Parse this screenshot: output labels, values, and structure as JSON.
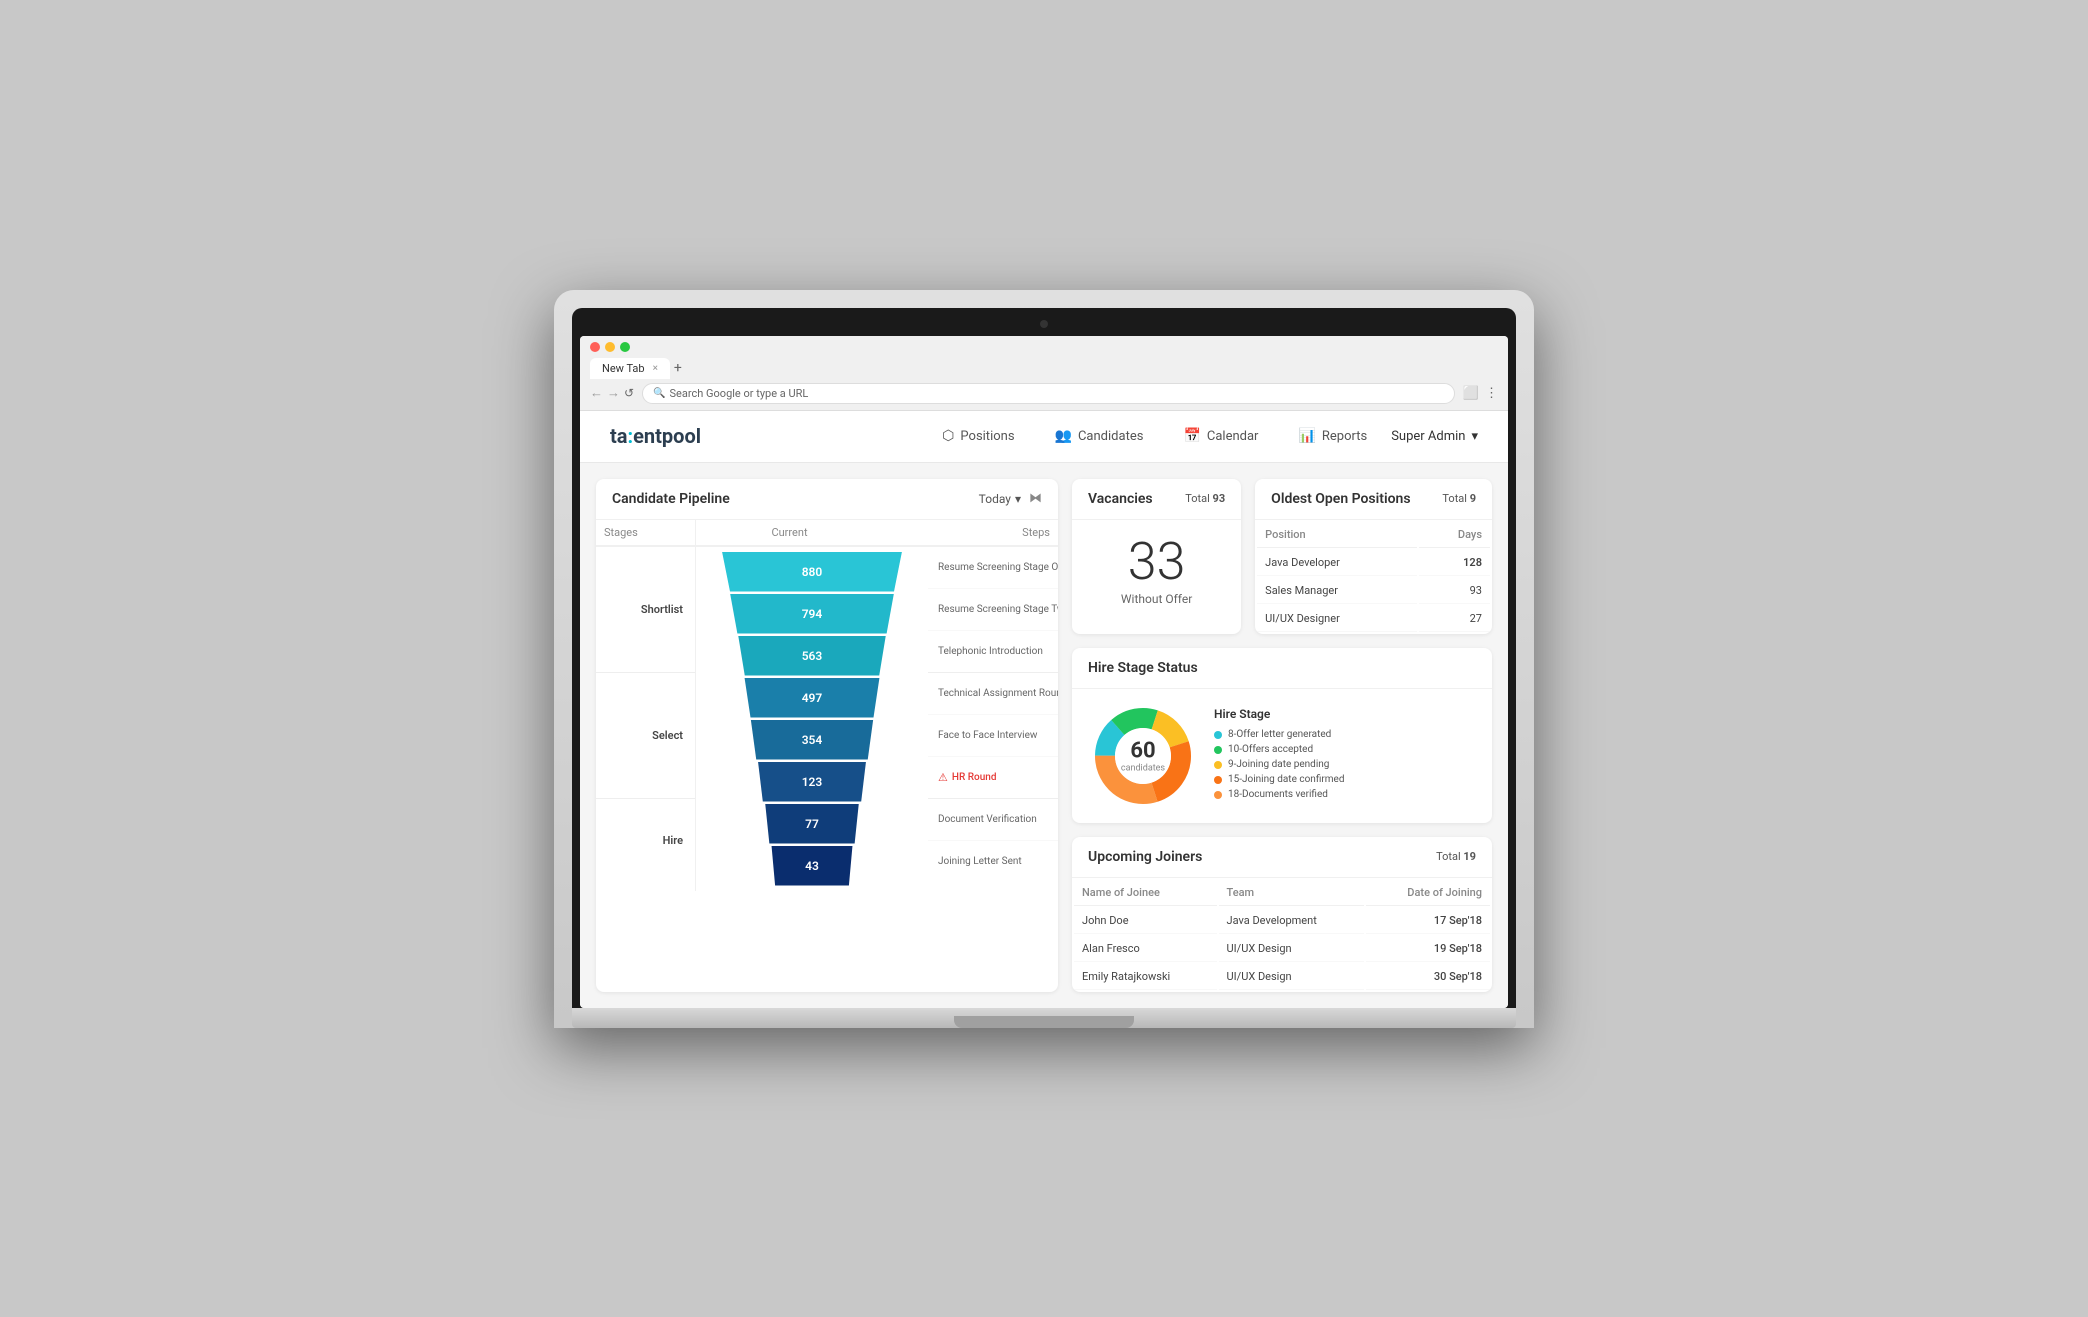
{
  "browser": {
    "tab_title": "New Tab",
    "address": "Search Google or type a URL",
    "nav_back": "←",
    "nav_forward": "→",
    "nav_refresh": "↺",
    "tab_close": "×",
    "tab_new": "+"
  },
  "app": {
    "logo": "talentpool",
    "admin_label": "Super Admin",
    "nav": [
      {
        "id": "positions",
        "icon": "⬡",
        "label": "Positions"
      },
      {
        "id": "candidates",
        "icon": "👥",
        "label": "Candidates"
      },
      {
        "id": "calendar",
        "icon": "📅",
        "label": "Calendar"
      },
      {
        "id": "reports",
        "icon": "📊",
        "label": "Reports"
      }
    ]
  },
  "pipeline": {
    "title": "Candidate Pipeline",
    "filter_today": "Today",
    "stages_col": "Stages",
    "current_col": "Current",
    "steps_col": "Steps",
    "rows": [
      {
        "stage": "Shortlist",
        "value": 880,
        "step": "Resume Screening Stage One",
        "span_start": true,
        "stage_rows": 3,
        "alert": false
      },
      {
        "stage": "",
        "value": 794,
        "step": "Resume Screening Stage Two",
        "alert": false
      },
      {
        "stage": "",
        "value": 563,
        "step": "Telephonic Introduction",
        "alert": false
      },
      {
        "stage": "Select",
        "value": 497,
        "step": "Technical Assignment Round",
        "span_start": true,
        "stage_rows": 3,
        "alert": false
      },
      {
        "stage": "",
        "value": 354,
        "step": "Face to Face Interview",
        "alert": false
      },
      {
        "stage": "",
        "value": 123,
        "step": "HR Round",
        "alert": true
      },
      {
        "stage": "Hire",
        "value": 77,
        "step": "Document Verification",
        "span_start": true,
        "stage_rows": 2,
        "alert": false
      },
      {
        "stage": "",
        "value": 43,
        "step": "Joining Letter Sent",
        "alert": false
      }
    ],
    "funnel_colors": [
      "#29c5d6",
      "#20b8cb",
      "#18a8bc",
      "#1a7faa",
      "#186b9a",
      "#164f89",
      "#0f3d7a",
      "#0a2d6e"
    ]
  },
  "vacancies": {
    "title": "Vacancies",
    "total_label": "Total",
    "total_value": "93",
    "number": "33",
    "sub_label": "Without Offer"
  },
  "oldest_positions": {
    "title": "Oldest Open Positions",
    "total_label": "Total",
    "total_value": "9",
    "col_position": "Position",
    "col_days": "Days",
    "rows": [
      {
        "position": "Java Developer",
        "days": "128",
        "highlight": true
      },
      {
        "position": "Sales Manager",
        "days": "93",
        "highlight": false
      },
      {
        "position": "UI/UX Designer",
        "days": "27",
        "highlight": false
      }
    ]
  },
  "hire_stage": {
    "title": "Hire Stage Status",
    "donut_number": "60",
    "donut_label": "candidates",
    "legend_title": "Hire Stage",
    "segments": [
      {
        "color": "#29c5d6",
        "label": "8-Offer letter generated"
      },
      {
        "color": "#22c55e",
        "label": "10-Offers accepted"
      },
      {
        "color": "#fbbf24",
        "label": "9-Joining date pending"
      },
      {
        "color": "#f97316",
        "label": "15-Joining date confirmed"
      },
      {
        "color": "#fb923c",
        "label": "18-Documents verified"
      }
    ],
    "donut_data": [
      {
        "value": 8,
        "color": "#29c5d6"
      },
      {
        "value": 10,
        "color": "#22c55e"
      },
      {
        "value": 9,
        "color": "#fbbf24"
      },
      {
        "value": 15,
        "color": "#f97316"
      },
      {
        "value": 18,
        "color": "#fb923c"
      }
    ]
  },
  "upcoming_joiners": {
    "title": "Upcoming Joiners",
    "total_label": "Total",
    "total_value": "19",
    "col_name": "Name of Joinee",
    "col_team": "Team",
    "col_date": "Date of Joining",
    "rows": [
      {
        "name": "John Doe",
        "team": "Java Development",
        "date": "17 Sep'18"
      },
      {
        "name": "Alan Fresco",
        "team": "UI/UX Design",
        "date": "19 Sep'18"
      },
      {
        "name": "Emily Ratajkowski",
        "team": "UI/UX Design",
        "date": "30 Sep'18"
      }
    ]
  }
}
